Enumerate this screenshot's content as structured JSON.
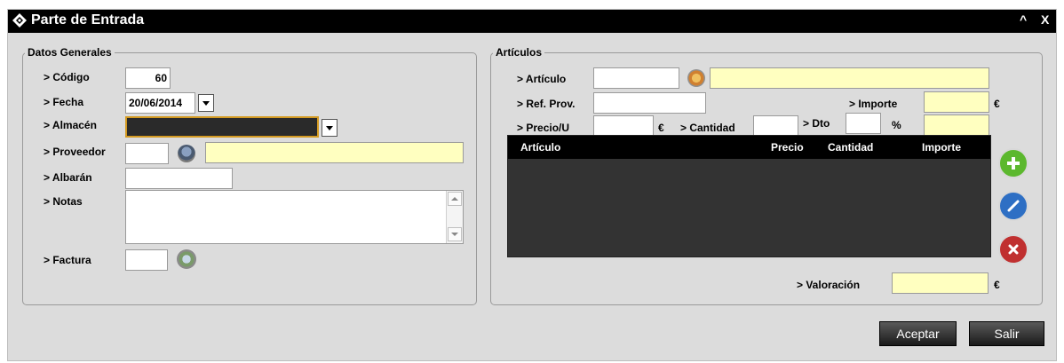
{
  "window": {
    "title": "Parte de Entrada",
    "minimize": "^",
    "close": "X"
  },
  "general": {
    "legend": "Datos Generales",
    "codigo": {
      "label": "> Código",
      "value": "60"
    },
    "fecha": {
      "label": "> Fecha",
      "value": "20/06/2014"
    },
    "almacen": {
      "label": "> Almacén",
      "value": ""
    },
    "proveedor": {
      "label": "> Proveedor",
      "code": "",
      "name": ""
    },
    "albaran": {
      "label": "> Albarán",
      "value": ""
    },
    "notas": {
      "label": "> Notas",
      "value": ""
    },
    "factura": {
      "label": "> Factura",
      "value": ""
    }
  },
  "articulos": {
    "legend": "Artículos",
    "articulo": {
      "label": "> Artículo",
      "code": "",
      "description": ""
    },
    "ref_prov": {
      "label": "> Ref. Prov.",
      "value": ""
    },
    "importe": {
      "label": "> Importe",
      "value": "",
      "unit": "€"
    },
    "precio_u": {
      "label": "> Precio/U",
      "value": "",
      "unit": "€"
    },
    "cantidad": {
      "label": "> Cantidad",
      "value": ""
    },
    "dto": {
      "label": "> Dto",
      "value": "",
      "unit": "%"
    },
    "dto_result": "",
    "table": {
      "columns": [
        "Artículo",
        "Precio",
        "Cantidad",
        "Importe"
      ],
      "rows": []
    },
    "valoracion": {
      "label": "> Valoración",
      "value": "",
      "unit": "€"
    }
  },
  "buttons": {
    "accept": "Aceptar",
    "exit": "Salir"
  },
  "colors": {
    "title_bg": "#000000",
    "panel_bg": "#dcdcdc",
    "yellow_field": "#ffffc0",
    "add": "#5cb82e",
    "edit": "#2e6fc4",
    "delete": "#c03030"
  }
}
